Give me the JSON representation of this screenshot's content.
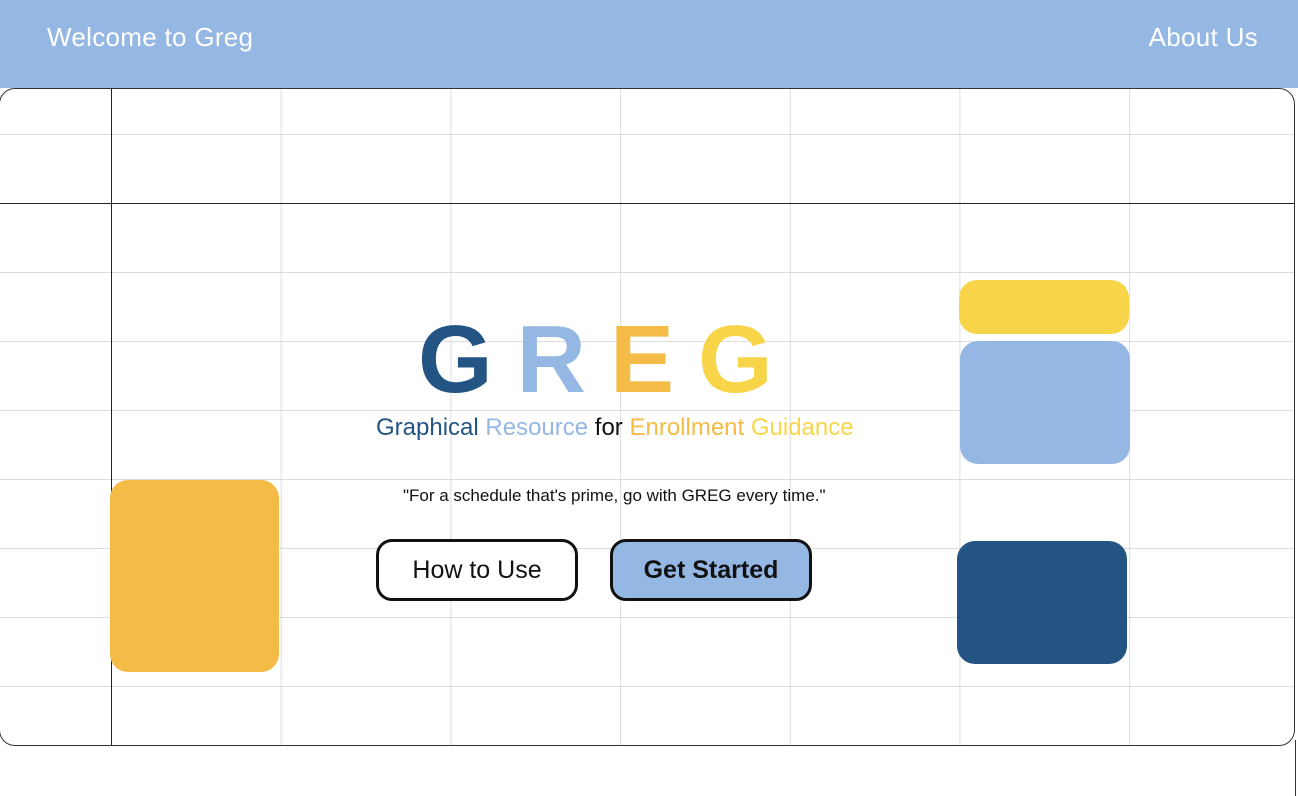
{
  "header": {
    "welcome": "Welcome to Greg",
    "about_link": "About Us"
  },
  "hero": {
    "logo_letters": [
      {
        "char": "G",
        "color": "#235484"
      },
      {
        "char": "R",
        "color": "#95b7e3"
      },
      {
        "char": "E",
        "color": "#f4bb46"
      },
      {
        "char": "G",
        "color": "#f8d448"
      }
    ],
    "subtitle_words": [
      {
        "text": "Graphical",
        "color": "#235484"
      },
      {
        "text": "Resource",
        "color": "#95b7e3"
      },
      {
        "text": "for",
        "color": "#111111"
      },
      {
        "text": "Enrollment",
        "color": "#f4bb46"
      },
      {
        "text": "Guidance",
        "color": "#f8d448"
      }
    ],
    "tagline": "\"For a schedule that's prime, go with GREG every time.\"",
    "how_to_use_label": "How to Use",
    "get_started_label": "Get Started"
  },
  "colors": {
    "header_bg": "#95b7e3",
    "navy": "#235484",
    "light_blue": "#95b7e3",
    "orange": "#f4bb46",
    "yellow": "#f8d448"
  }
}
